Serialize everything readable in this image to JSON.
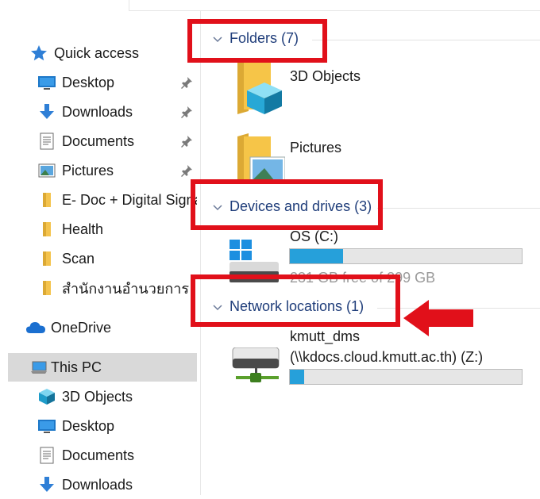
{
  "navigation": {
    "quick_access": {
      "label": "Quick access",
      "items": [
        {
          "label": "Desktop",
          "pinned": true
        },
        {
          "label": "Downloads",
          "pinned": true
        },
        {
          "label": "Documents",
          "pinned": true
        },
        {
          "label": "Pictures",
          "pinned": true
        },
        {
          "label": "E- Doc + Digital Signature",
          "pinned": false
        },
        {
          "label": "Health",
          "pinned": false
        },
        {
          "label": "Scan",
          "pinned": false
        },
        {
          "label": "สำนักงานอำนวยการ",
          "pinned": false
        }
      ]
    },
    "onedrive": {
      "label": "OneDrive"
    },
    "this_pc": {
      "label": "This PC",
      "selected": true,
      "items": [
        {
          "label": "3D Objects"
        },
        {
          "label": "Desktop"
        },
        {
          "label": "Documents"
        },
        {
          "label": "Downloads"
        }
      ]
    }
  },
  "content": {
    "folders": {
      "header": "Folders (7)",
      "items": [
        {
          "name": "3D Objects"
        },
        {
          "name": "Pictures"
        }
      ]
    },
    "devices": {
      "header": "Devices and drives (3)",
      "items": [
        {
          "name": "OS (C:)",
          "usage_fraction": 0.23,
          "free_text": "231 GB free of 299 GB"
        }
      ]
    },
    "network": {
      "header": "Network locations (1)",
      "items": [
        {
          "name": "kmutt_dms",
          "path": "(\\\\kdocs.cloud.kmutt.ac.th) (Z:)",
          "usage_fraction": 0.06
        }
      ]
    }
  },
  "annotation_colors": {
    "highlight": "#e1101a",
    "progress": "#26a0da",
    "header_text": "#1f3d7a"
  }
}
